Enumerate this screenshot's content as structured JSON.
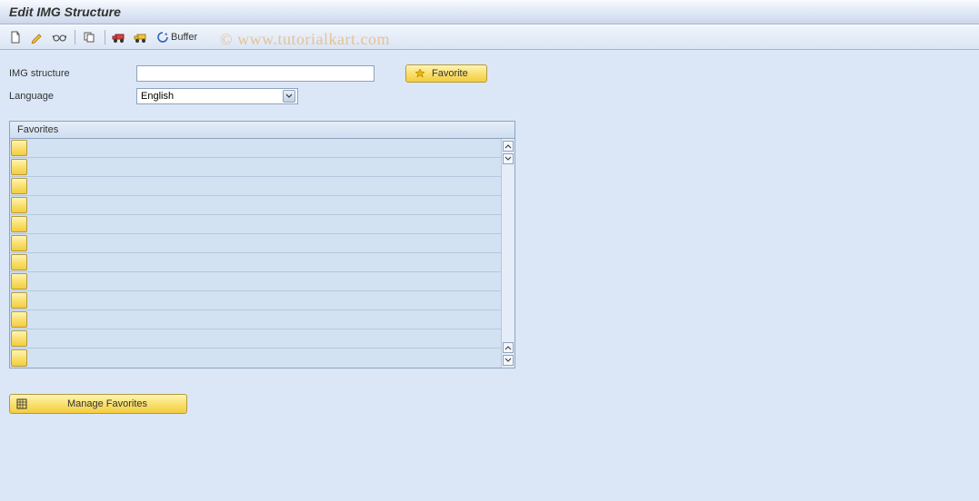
{
  "title": "Edit IMG Structure",
  "toolbar": {
    "buffer_label": "Buffer"
  },
  "form": {
    "img_structure_label": "IMG structure",
    "img_structure_value": "",
    "language_label": "Language",
    "language_value": "English",
    "favorite_button": "Favorite"
  },
  "favorites": {
    "header": "Favorites",
    "rows": [
      "",
      "",
      "",
      "",
      "",
      "",
      "",
      "",
      "",
      "",
      "",
      ""
    ]
  },
  "manage_btn": "Manage Favorites",
  "watermark": "©  www.tutorialkart.com"
}
